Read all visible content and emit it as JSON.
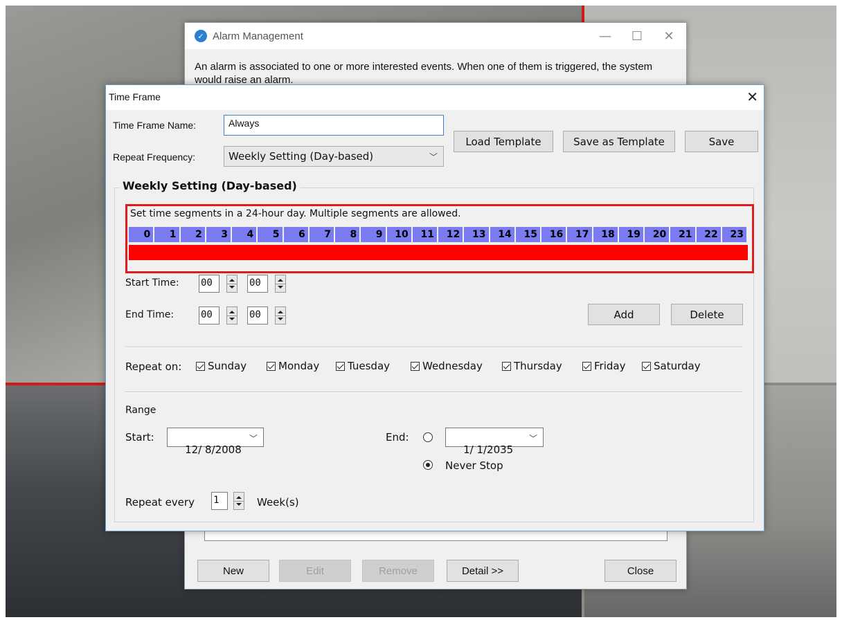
{
  "alarm_window": {
    "title": "Alarm Management",
    "description": "An alarm is associated to one or more interested events. When one of them is triggered, the system would raise an alarm.",
    "buttons": {
      "new": "New",
      "edit": "Edit",
      "remove": "Remove",
      "detail": "Detail >>",
      "close": "Close"
    },
    "controls": {
      "minimize": "—",
      "maximize": "☐",
      "close": "✕"
    }
  },
  "time_frame": {
    "title": "Time Frame",
    "close": "✕",
    "name_label": "Time Frame Name:",
    "name_value": "Always",
    "repeat_label": "Repeat Frequency:",
    "repeat_value": "Weekly Setting (Day-based)",
    "buttons": {
      "load_template": "Load Template",
      "save_template": "Save as Template",
      "save": "Save",
      "add": "Add",
      "delete": "Delete"
    },
    "group_title": "Weekly Setting (Day-based)",
    "timeline_note": "Set time segments in a 24-hour day. Multiple segments are allowed.",
    "hours": [
      "0",
      "1",
      "2",
      "3",
      "4",
      "5",
      "6",
      "7",
      "8",
      "9",
      "10",
      "11",
      "12",
      "13",
      "14",
      "15",
      "16",
      "17",
      "18",
      "19",
      "20",
      "21",
      "22",
      "23"
    ],
    "segment_color": "#ff0000",
    "hour_color": "#7b7bf2",
    "start_label": "Start Time:",
    "start_hour": "00",
    "start_min": "00",
    "end_label": "End Time:",
    "end_hour": "00",
    "end_min": "00",
    "repeat_on_label": "Repeat on:",
    "days": [
      "Sunday",
      "Monday",
      "Tuesday",
      "Wednesday",
      "Thursday",
      "Friday",
      "Saturday"
    ],
    "range_label": "Range",
    "range_start_label": "Start:",
    "range_start_value": "12/ 8/2008",
    "range_end_label": "End:",
    "range_end_value": "1/ 1/2035",
    "never_stop_label": "Never Stop",
    "repeat_every_label": "Repeat every",
    "repeat_every_value": "1",
    "repeat_every_unit": "Week(s)"
  },
  "colors": {
    "selection_border": "#dd1c1c",
    "accent": "#2d7fd3"
  }
}
